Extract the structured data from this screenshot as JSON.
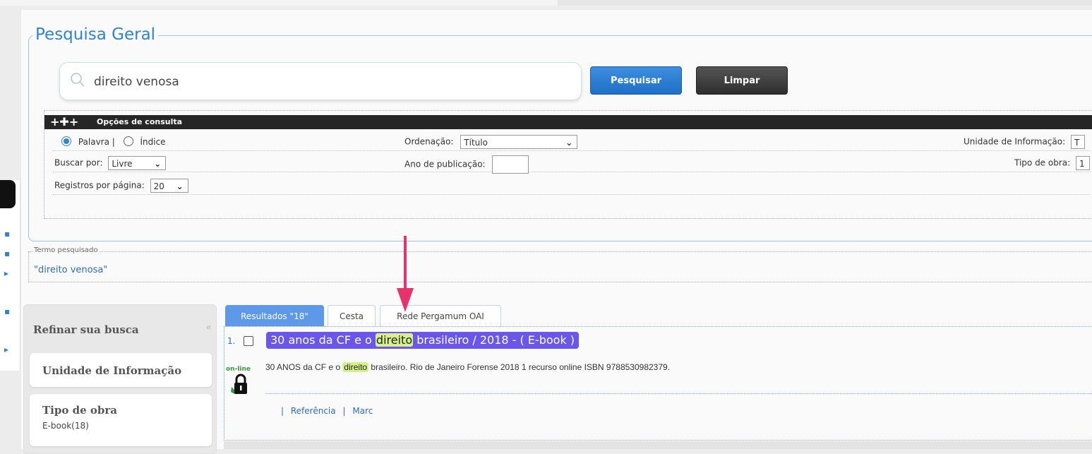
{
  "header": {
    "title": "Pesquisa Geral"
  },
  "search": {
    "value": "direito venosa",
    "placeholder": ""
  },
  "buttons": {
    "search": "Pesquisar",
    "clear": "Limpar"
  },
  "options": {
    "bar_label": "Opções de consulta",
    "radio_palavra": "Palavra |",
    "radio_indice": "Índice",
    "ordenacao_label": "Ordenação:",
    "ordenacao_value": "Título",
    "unidade_label": "Unidade de Informação:",
    "unidade_value": "T",
    "buscar_label": "Buscar por:",
    "buscar_value": "Livre",
    "ano_label": "Ano de publicação:",
    "ano_value": "",
    "tipo_label": "Tipo de obra:",
    "tipo_value": "1",
    "registros_label": "Registros por página:",
    "registros_value": "20"
  },
  "termo": {
    "legend": "Termo pesquisado",
    "value": "\"direito venosa\""
  },
  "refine": {
    "title": "Refinar sua busca",
    "cards": [
      {
        "title": "Unidade de Informação",
        "sub": ""
      },
      {
        "title": "Tipo de obra",
        "sub": "E-book(18)"
      }
    ]
  },
  "tabs": [
    {
      "label": "Resultados \"18\"",
      "active": true
    },
    {
      "label": "Cesta",
      "active": false
    },
    {
      "label": "Rede Pergamum OAI",
      "active": false
    }
  ],
  "result": {
    "number": "1.",
    "title_pre": "30 anos da CF e o ",
    "title_hl": "direito",
    "title_post": " brasileiro / 2018 - ( E-book )",
    "desc_pre": "30 ANOS da CF e o ",
    "desc_hl": "direito",
    "desc_post": " brasileiro. Rio de Janeiro Forense 2018 1 recurso online ISBN 9788530982379.",
    "online_label": "on-line",
    "link_referencia": "Referência",
    "link_marc": "Marc",
    "link_sep": "|"
  },
  "colors": {
    "accent": "#2e84d0",
    "title_bg": "#6a56ea",
    "highlight": "#d6f08a",
    "arrow": "#e8336a"
  }
}
